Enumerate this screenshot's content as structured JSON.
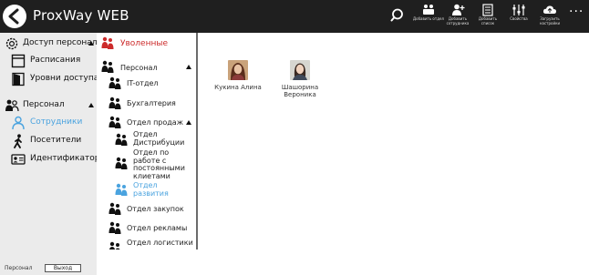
{
  "app": {
    "title": "ProxWay WEB"
  },
  "toolbar": {
    "buttons": [
      {
        "label": "Добавить отдел",
        "icon": "add-department-icon"
      },
      {
        "label": "Добавить сотрудника",
        "icon": "add-employee-icon"
      },
      {
        "label": "Добавить список",
        "icon": "add-list-icon"
      },
      {
        "label": "Свойства",
        "icon": "properties-icon"
      },
      {
        "label": "Загрузить настройки",
        "icon": "cloud-upload-icon"
      }
    ],
    "more": "···"
  },
  "sidebar": {
    "sections": [
      {
        "label": "Доступ персонала",
        "icon": "gear-icon"
      },
      {
        "label": "Расписания",
        "icon": "schedule-icon"
      },
      {
        "label": "Уровни доступа",
        "icon": "door-icon"
      },
      {
        "label": "Персонал",
        "icon": "staff-icon"
      },
      {
        "label": "Сотрудники",
        "icon": "employees-icon"
      },
      {
        "label": "Посетители",
        "icon": "walking-person-icon"
      },
      {
        "label": "Идентификаторы",
        "icon": "id-card-icon"
      }
    ]
  },
  "tree": {
    "fired": "Уволенные",
    "root": "Персонал",
    "items": [
      "IT-отдел",
      "Бухгалтерия",
      "Отдел продаж",
      "Отдел Дистрибуции",
      "Отдел по работе с постоянными клиетами",
      "Отдел развития",
      "Отдел закупок",
      "Отдел рекламы",
      "Отдел логистики"
    ]
  },
  "employees": [
    {
      "name": "Кукина Алина"
    },
    {
      "name": "Шашорина Вероника"
    }
  ],
  "footer": {
    "user": "Персонал",
    "logout": "Выход"
  },
  "colors": {
    "topbar": "#1f1f1f",
    "sidebar": "#ebebeb",
    "accent": "#4aa3df",
    "fired": "#cc2b2b"
  }
}
